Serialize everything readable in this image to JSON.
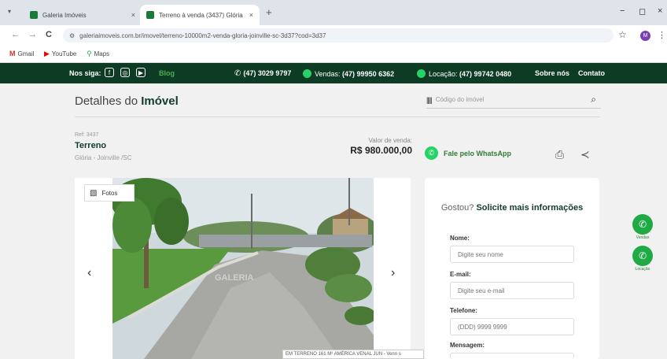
{
  "browser": {
    "tabs": [
      {
        "title": "Galeria Imóveis",
        "close": "×"
      },
      {
        "title": "Terreno à venda (3437) Glória - ",
        "close": "×"
      }
    ],
    "tab_search": "▾",
    "new_tab": "+",
    "window_controls": {
      "minimize": "−",
      "maximize": "◻",
      "close": "×"
    },
    "url": "galeriaimoveis.com.br/imovel/terreno-10000m2-venda-gloria-joinville-sc-3d37?cod=3d37",
    "nav": {
      "back": "←",
      "forward": "→",
      "reload": "C"
    },
    "star": "☆",
    "profile_initial": "M",
    "menu": "⋮",
    "bookmarks": [
      {
        "label": "Gmail",
        "icon": "M"
      },
      {
        "label": "YouTube",
        "icon": "▶"
      },
      {
        "label": "Maps",
        "icon": "⚲"
      }
    ]
  },
  "header": {
    "follow_label": "Nos siga:",
    "social_icons": [
      "f",
      "◎",
      "▶"
    ],
    "blog": "Blog",
    "phone": "(47) 3029 9797",
    "vendas_label": "Vendas:",
    "vendas_phone": "(47) 99950 6362",
    "locacao_label": "Locação:",
    "locacao_phone": "(47) 99742 0480",
    "about": "Sobre nós",
    "contact": "Contato"
  },
  "page": {
    "title_prefix": "Detalhes do",
    "title_bold": "Imóvel",
    "search_icon_text": "|||||",
    "search_placeholder": "Código do imóvel",
    "search_mag": "⌕"
  },
  "property": {
    "ref": "Ref: 3437",
    "type": "Terreno",
    "location": "Glória - Joinville /SC",
    "price_label": "Valor de venda:",
    "price": "R$ 980.000,00",
    "whatsapp_cta": "Fale pelo WhatsApp",
    "print_icon": "⎙",
    "share_icon": "≺"
  },
  "gallery": {
    "photos_button": "Fotos",
    "photos_icon": "▧",
    "prev": "‹",
    "next": "›",
    "caption": "EM TERRENO 161 M² AMÉRICA VENAL JUN - Venn s"
  },
  "form": {
    "title_plain": "Gostou?",
    "title_bold": "Solicite mais informações",
    "fields": [
      {
        "label": "Nome:",
        "placeholder": "Digite seu nome"
      },
      {
        "label": "E-mail:",
        "placeholder": "Digite seu e-mail"
      },
      {
        "label": "Telefone:",
        "placeholder": "(DDD) 9999 9999"
      },
      {
        "label": "Mensagem:",
        "placeholder": ""
      }
    ]
  },
  "floating": [
    {
      "label": "Vendas",
      "icon": "✆"
    },
    {
      "label": "Locação",
      "icon": "✆"
    }
  ],
  "colors": {
    "brand_dark_green": "#0d3b24",
    "whatsapp_green": "#25d366",
    "accent_green": "#2e7d32"
  }
}
